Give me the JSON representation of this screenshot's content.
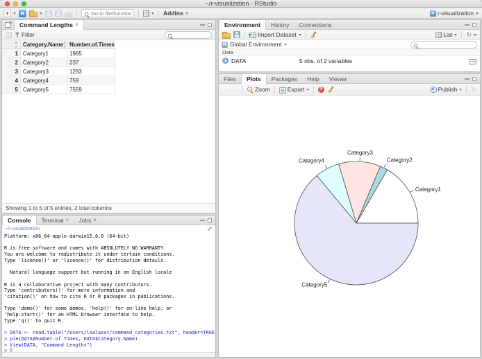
{
  "window": {
    "title": "~/r-visualization - RStudio"
  },
  "toolbar": {
    "goto_placeholder": "Go to file/function",
    "addins_label": "Addins",
    "project_label": "r-visualization"
  },
  "viewer": {
    "tab_title": "Command Lengths",
    "filter_label": "Filter",
    "columns": [
      "Category.Name",
      "Number.of.Times"
    ],
    "rows": [
      [
        "1",
        "Category1",
        "1965"
      ],
      [
        "2",
        "Category2",
        "237"
      ],
      [
        "3",
        "Category3",
        "1293"
      ],
      [
        "4",
        "Category4",
        "759"
      ],
      [
        "5",
        "Category5",
        "7559"
      ]
    ],
    "footer": "Showing 1 to 5 of 5 entries, 2 total columns"
  },
  "console": {
    "tabs": [
      "Console",
      "Terminal",
      "Jobs"
    ],
    "path": "~/r-visualization/",
    "lines": [
      {
        "text": "Platform: x86_64-apple-darwin15.6.0 (64-bit)",
        "kind": "out"
      },
      {
        "text": "",
        "kind": "out"
      },
      {
        "text": "R is free software and comes with ABSOLUTELY NO WARRANTY.",
        "kind": "out"
      },
      {
        "text": "You are welcome to redistribute it under certain conditions.",
        "kind": "out"
      },
      {
        "text": "Type 'license()' or 'licence()' for distribution details.",
        "kind": "out"
      },
      {
        "text": "",
        "kind": "out"
      },
      {
        "text": "  Natural language support but running in an English locale",
        "kind": "out"
      },
      {
        "text": "",
        "kind": "out"
      },
      {
        "text": "R is a collaborative project with many contributors.",
        "kind": "out"
      },
      {
        "text": "Type 'contributors()' for more information and",
        "kind": "out"
      },
      {
        "text": "'citation()' on how to cite R or R packages in publications.",
        "kind": "out"
      },
      {
        "text": "",
        "kind": "out"
      },
      {
        "text": "Type 'demo()' for some demos, 'help()' for on-line help, or",
        "kind": "out"
      },
      {
        "text": "'help.start()' for an HTML browser interface to help.",
        "kind": "out"
      },
      {
        "text": "Type 'q()' to quit R.",
        "kind": "out"
      },
      {
        "text": "",
        "kind": "out"
      },
      {
        "text": "> DATA <- read.table(\"/Users/lsalazar/command_categories.txt\", header=TRUE)",
        "kind": "cmd"
      },
      {
        "text": "> pie(DATA$Number.of.Times, DATA$Category.Name)",
        "kind": "cmd"
      },
      {
        "text": "> View(DATA, \"Command Lengths\")",
        "kind": "cmd"
      },
      {
        "text": "> ",
        "kind": "prompt"
      }
    ]
  },
  "environment": {
    "tabs": [
      "Environment",
      "History",
      "Connections"
    ],
    "import_label": "Import Dataset",
    "list_label": "List",
    "scope_label": "Global Environment",
    "section_label": "Data",
    "object_name": "DATA",
    "object_desc": "5 obs. of 2 variables"
  },
  "plots": {
    "tabs": [
      "Files",
      "Plots",
      "Packages",
      "Help",
      "Viewer"
    ],
    "zoom_label": "Zoom",
    "export_label": "Export",
    "publish_label": "Publish"
  },
  "chart_data": {
    "type": "pie",
    "title": "",
    "categories": [
      "Category1",
      "Category2",
      "Category3",
      "Category4",
      "Category5"
    ],
    "values": [
      1965,
      237,
      1293,
      759,
      7559
    ],
    "colors": [
      "#FFFFFF",
      "#ADD8E6",
      "#FFE4E1",
      "#E0FFFF",
      "#E6E6FA"
    ],
    "start_angle_deg": 0,
    "direction": "counterclockwise",
    "stroke_color": "#4a4a4a",
    "label_color": "#1a1a1a",
    "label_font_size": 8,
    "legend": "none"
  }
}
